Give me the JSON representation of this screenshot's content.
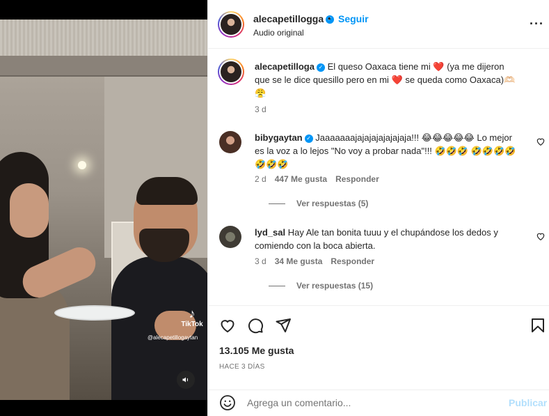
{
  "media": {
    "watermark_brand": "TikTok",
    "watermark_user": "@alecapetillogaytan"
  },
  "header": {
    "username": "alecapetillogga",
    "follow_label": "Seguir",
    "audio_label": "Audio original",
    "separator": "•",
    "more_label": "···"
  },
  "caption": {
    "username": "alecapetilloga",
    "text_part1": "El queso Oaxaca tiene mi",
    "text_part2": "(ya me dijeron que se le dice quesillo pero en mi",
    "text_part3": "se queda como Oaxaca)",
    "emoji_hand": "🫶🏻",
    "emoji_face": "😤",
    "emoji_heart": "❤️",
    "time": "3 d"
  },
  "comments": [
    {
      "username": "bibygaytan",
      "verified": true,
      "text_a": "Jaaaaaaajajajajajajajaja!!!",
      "laugh_emojis": "😂😂😂😂😂",
      "text_b": "Lo mejor es la voz a lo lejos \"No voy a probar nada\"!!!",
      "rofl_emojis": "🤣🤣🤣",
      "rofl_emojis_2": "🤣🤣🤣🤣🤣🤣🤣",
      "time": "2 d",
      "likes": "447 Me gusta",
      "reply_label": "Responder",
      "view_replies": "Ver respuestas (5)"
    },
    {
      "username": "lyd_sal",
      "verified": false,
      "text": "Hay Ale tan bonita tuuu y el chupándose los dedos y comiendo con la boca abierta.",
      "time": "3 d",
      "likes": "34 Me gusta",
      "reply_label": "Responder",
      "view_replies": "Ver respuestas (15)"
    }
  ],
  "actions": {
    "likes": "13.105 Me gusta",
    "ago": "HACE 3 DÍAS"
  },
  "add_comment": {
    "placeholder": "Agrega un comentario...",
    "publish_label": "Publicar"
  },
  "colors": {
    "accent": "#0095f6",
    "heart": "#ed4956",
    "muted": "#737373",
    "publish_disabled": "#b2dffc"
  }
}
